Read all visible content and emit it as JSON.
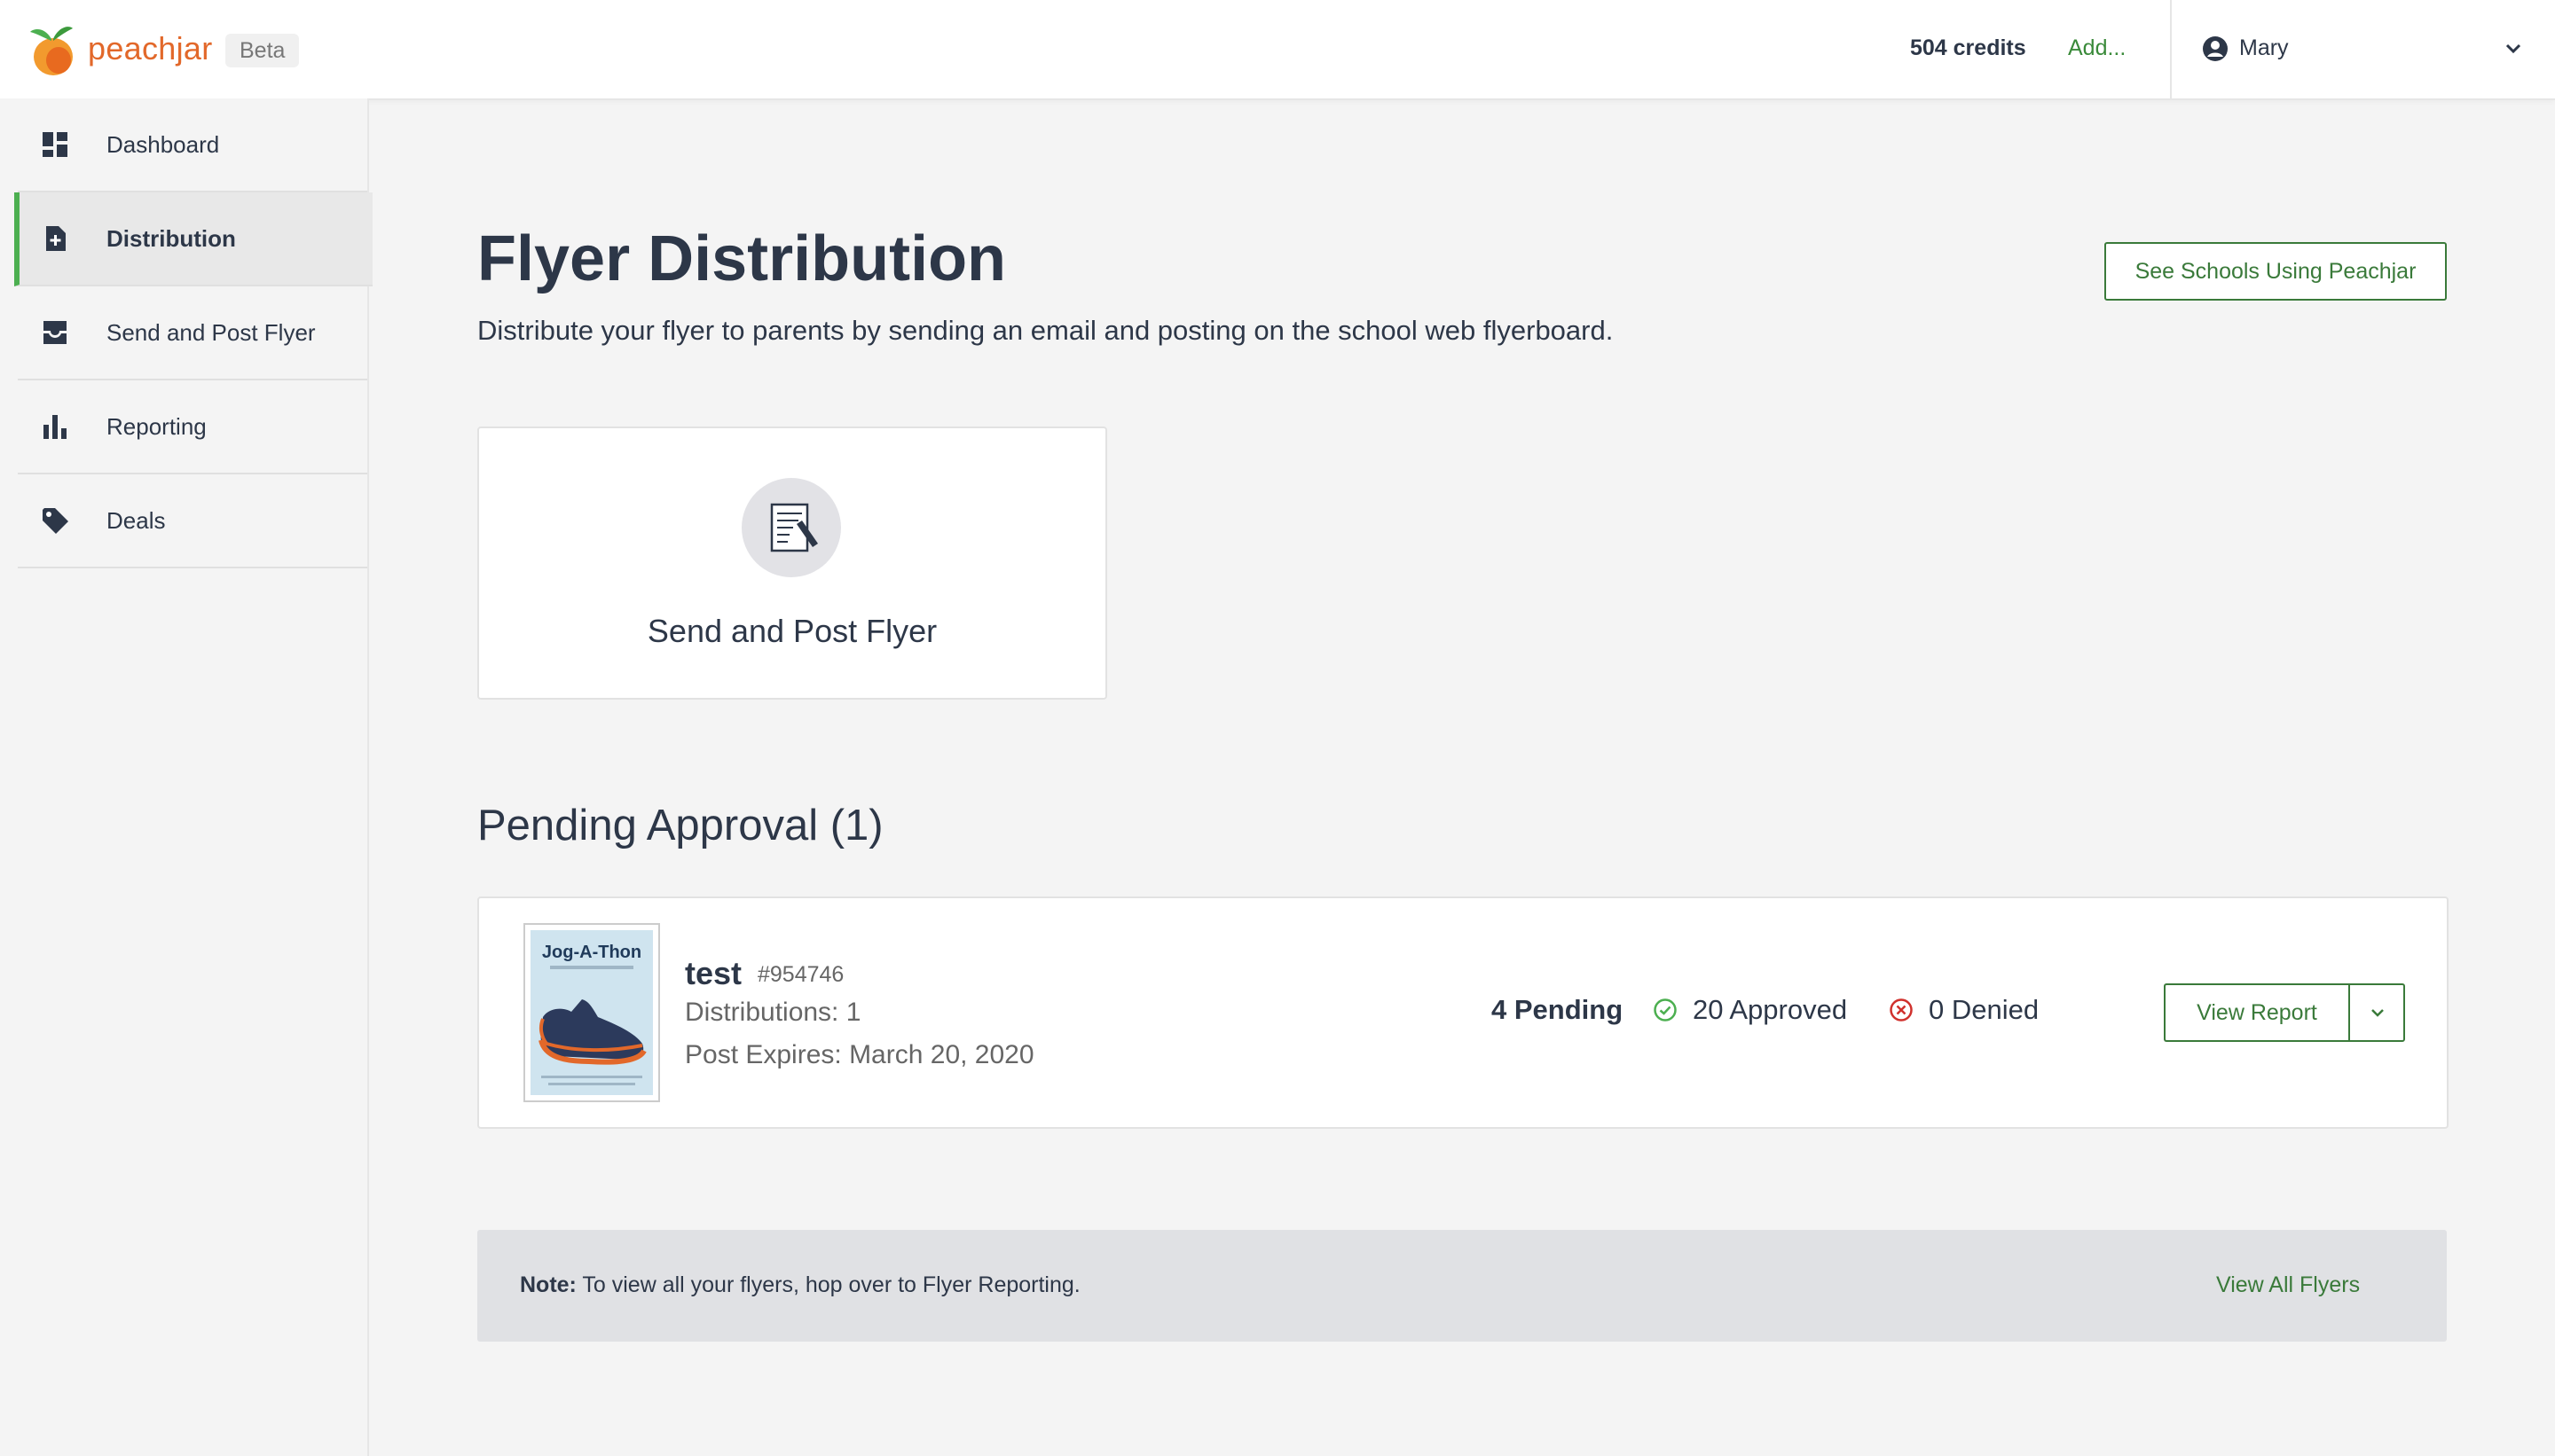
{
  "header": {
    "brand": "peachjar",
    "badge": "Beta",
    "credits": "504 credits",
    "add_link": "Add...",
    "user_name": "Mary"
  },
  "sidebar": {
    "items": [
      {
        "label": "Dashboard",
        "icon": "dashboard-icon",
        "active": false
      },
      {
        "label": "Distribution",
        "icon": "document-plus-icon",
        "active": true
      },
      {
        "label": "Send and Post Flyer",
        "icon": "inbox-tray-icon",
        "active": false
      },
      {
        "label": "Reporting",
        "icon": "bar-chart-icon",
        "active": false
      },
      {
        "label": "Deals",
        "icon": "tag-icon",
        "active": false
      }
    ]
  },
  "main": {
    "title": "Flyer Distribution",
    "subtitle": "Distribute your flyer to parents by sending an email and posting on the school web flyerboard.",
    "see_schools_button": "See Schools Using Peachjar",
    "action_card": {
      "label": "Send and Post Flyer",
      "icon": "document-edit-icon"
    },
    "pending_section_title": "Pending Approval (1)",
    "flyers": [
      {
        "thumbnail_title": "Jog-A-Thon",
        "name": "test",
        "id": "#954746",
        "distributions": "Distributions: 1",
        "expires": "Post Expires: March 20, 2020",
        "pending": "4 Pending",
        "approved": "20 Approved",
        "denied": "0 Denied",
        "view_report_button": "View Report"
      }
    ],
    "note": {
      "label": "Note:",
      "text": "To view all your flyers, hop over to Flyer Reporting.",
      "link": "View All Flyers"
    }
  },
  "colors": {
    "brand_orange": "#e2682a",
    "accent_green": "#3a7a3a",
    "active_nav_border": "#4caf50",
    "approved_green": "#4caf50",
    "denied_red": "#d0312d"
  }
}
